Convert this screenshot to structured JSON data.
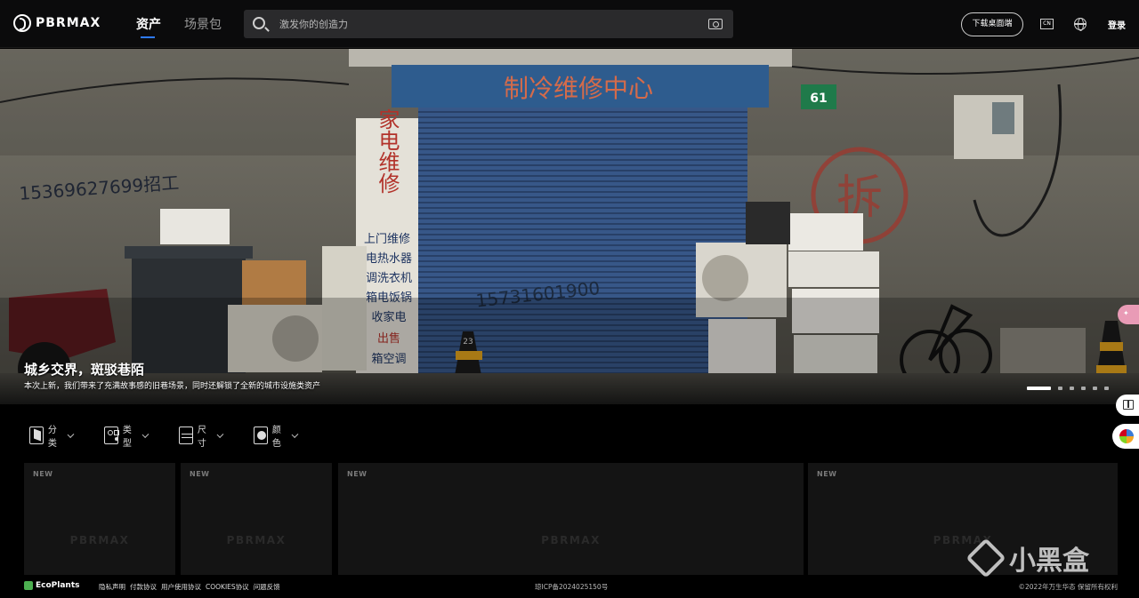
{
  "header": {
    "logo_text": "PBRMAX",
    "nav": [
      {
        "label": "资产",
        "active": true
      },
      {
        "label": "场景包",
        "active": false
      }
    ],
    "search_placeholder": "激发你的创造力",
    "download_label": "下载桌面端",
    "lang_label": "CN",
    "login_label": "登录"
  },
  "hero": {
    "title": "城乡交界，斑驳巷陌",
    "subtitle": "本次上新，我们带来了充满故事感的旧巷场景，同时还解锁了全新的城市设施类资产",
    "slide_count": 6,
    "active_slide": 0,
    "scene_text": {
      "sign_top": "制冷维修中心",
      "sign_vertical": "家电维修",
      "sign_list": [
        "上门维修",
        "电热水器",
        "调洗衣机",
        "箱电饭锅",
        "收家电",
        "出售",
        "箱空调"
      ],
      "phone_left": "15369627699招工",
      "phone_shutter": "15731601900",
      "house_number": "61",
      "demolish": "拆",
      "cone_number": "23"
    }
  },
  "filters": [
    {
      "label": "分类",
      "icon": "category-icon"
    },
    {
      "label": "类型",
      "icon": "type-icon"
    },
    {
      "label": "尺寸",
      "icon": "size-icon"
    },
    {
      "label": "颜色",
      "icon": "color-icon"
    }
  ],
  "cards": [
    {
      "badge": "NEW",
      "placeholder": "PBRMAX"
    },
    {
      "badge": "NEW",
      "placeholder": "PBRMAX"
    },
    {
      "badge": "NEW",
      "placeholder": "PBRMAX"
    },
    {
      "badge": "NEW",
      "placeholder": "PBRMAX"
    }
  ],
  "footer": {
    "brand": "EcoPlants",
    "links": [
      "隐私声明",
      "付款协议",
      "用户使用协议",
      "COOKIES协议",
      "问题反馈"
    ],
    "icp": "琼ICP备2024025150号",
    "copyright": "©2022年万生华态 保留所有权利"
  },
  "watermark": "小黑盒",
  "colors": {
    "accent": "#2e7bff",
    "shutter": "#3c5f94",
    "background": "#000000"
  }
}
